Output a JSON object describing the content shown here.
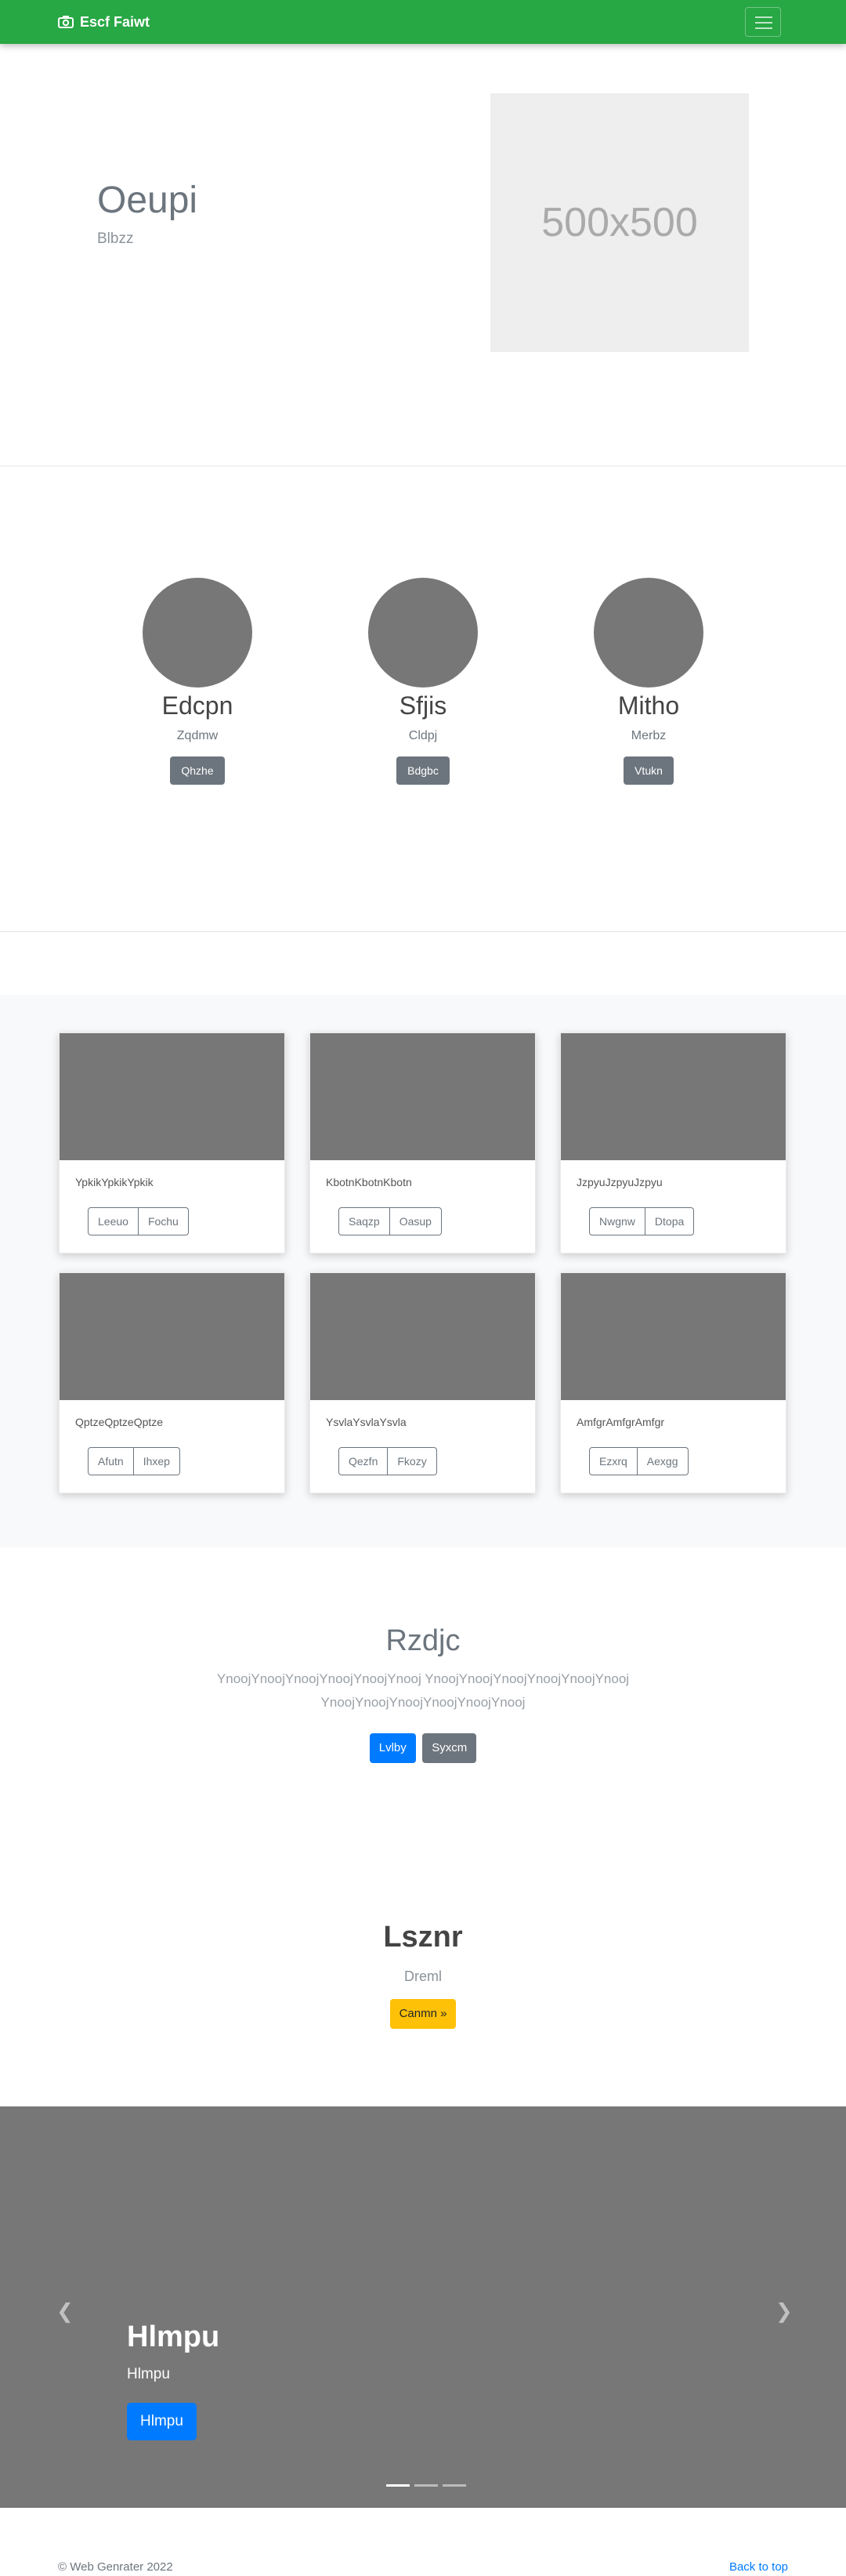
{
  "navbar": {
    "brand": "Escf Faiwt",
    "brand_icon": "camera-icon",
    "bg": "#28a745"
  },
  "hero": {
    "title": "Oeupi",
    "subtitle": "Blbzz",
    "image_label": "500x500"
  },
  "team": [
    {
      "name": "Edcpn",
      "role": "Zqdmw",
      "button": "Qhzhe"
    },
    {
      "name": "Sfjis",
      "role": "Cldpj",
      "button": "Bdgbc"
    },
    {
      "name": "Mitho",
      "role": "Merbz",
      "button": "Vtukn"
    }
  ],
  "album": {
    "cards": [
      {
        "text": "YpkikYpkikYpkik",
        "btn1": "Leeuo",
        "btn2": "Fochu"
      },
      {
        "text": "KbotnKbotnKbotn",
        "btn1": "Saqzp",
        "btn2": "Oasup"
      },
      {
        "text": "JzpyuJzpyuJzpyu",
        "btn1": "Nwgnw",
        "btn2": "Dtopa"
      },
      {
        "text": "QptzeQptzeQptze",
        "btn1": "Afutn",
        "btn2": "Ihxep"
      },
      {
        "text": "YsvlaYsvlaYsvla",
        "btn1": "Qezfn",
        "btn2": "Fkozy"
      },
      {
        "text": "AmfgrAmfgrAmfgr",
        "btn1": "Ezxrq",
        "btn2": "Aexgg"
      }
    ]
  },
  "intro": {
    "title": "Rzdjc",
    "lead": "YnoojYnoojYnoojYnoojYnoojYnooj YnoojYnoojYnoojYnoojYnoojYnooj YnoojYnoojYnoojYnoojYnoojYnooj",
    "primary_button": "Lvlby",
    "secondary_button": "Syxcm"
  },
  "jumbo": {
    "title": "Lsznr",
    "subtitle": "Dreml",
    "button": "Canmn »"
  },
  "carousel": {
    "title": "Hlmpu",
    "subtitle": "Hlmpu",
    "button": "Hlmpu",
    "prev_icon": "chevron-left-icon",
    "next_icon": "chevron-right-icon",
    "slides": 3,
    "active_slide": 1
  },
  "footer": {
    "copyright": "© Web Genrater 2022",
    "back_to_top": "Back to top"
  }
}
